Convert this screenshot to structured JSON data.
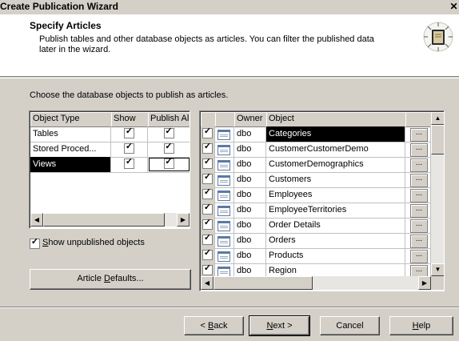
{
  "window": {
    "title": "Create Publication Wizard",
    "close_glyph": "✕"
  },
  "header": {
    "title": "Specify Articles",
    "description_line1": "Publish tables and other database objects as articles. You can filter the published data",
    "description_line2": "later in the wizard."
  },
  "instructions": "Choose the database objects to publish as articles.",
  "object_types": {
    "columns": [
      "Object Type",
      "Show",
      "Publish All"
    ],
    "rows": [
      {
        "type": "Tables",
        "show": true,
        "publish_all": true,
        "selected": false
      },
      {
        "type": "Stored Proced...",
        "show": true,
        "publish_all": true,
        "selected": false
      },
      {
        "type": "Views",
        "show": true,
        "publish_all": true,
        "selected": true
      }
    ]
  },
  "articles": {
    "columns": [
      "",
      "",
      "Owner",
      "Object",
      ""
    ],
    "rows": [
      {
        "checked": true,
        "owner": "dbo",
        "object": "Categories",
        "selected": true
      },
      {
        "checked": true,
        "owner": "dbo",
        "object": "CustomerCustomerDemo",
        "selected": false
      },
      {
        "checked": true,
        "owner": "dbo",
        "object": "CustomerDemographics",
        "selected": false
      },
      {
        "checked": true,
        "owner": "dbo",
        "object": "Customers",
        "selected": false
      },
      {
        "checked": true,
        "owner": "dbo",
        "object": "Employees",
        "selected": false
      },
      {
        "checked": true,
        "owner": "dbo",
        "object": "EmployeeTerritories",
        "selected": false
      },
      {
        "checked": true,
        "owner": "dbo",
        "object": "Order Details",
        "selected": false
      },
      {
        "checked": true,
        "owner": "dbo",
        "object": "Orders",
        "selected": false
      },
      {
        "checked": true,
        "owner": "dbo",
        "object": "Products",
        "selected": false
      },
      {
        "checked": true,
        "owner": "dbo",
        "object": "Region",
        "selected": false
      }
    ],
    "ellipsis": "..."
  },
  "show_unpublished": {
    "checked": true,
    "label_prefix": "",
    "label_mnemonic": "S",
    "label_rest": "how unpublished objects"
  },
  "article_defaults_button": {
    "prefix": "Article ",
    "mnemonic": "D",
    "rest": "efaults..."
  },
  "footer": {
    "back": {
      "prefix": "< ",
      "mnemonic": "B",
      "rest": "ack"
    },
    "next": {
      "prefix": "",
      "mnemonic": "N",
      "rest": "ext >"
    },
    "cancel": "Cancel",
    "help": {
      "mnemonic": "H",
      "rest": "elp"
    }
  },
  "colors": {
    "selection": "#000000",
    "face": "#d4d0c8",
    "window": "#ffffff"
  }
}
